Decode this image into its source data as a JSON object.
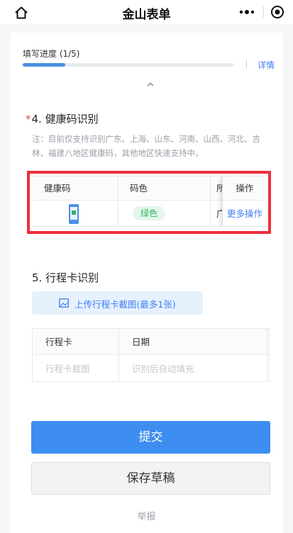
{
  "header": {
    "title": "金山表单"
  },
  "progress": {
    "label": "填写进度 (1/5)",
    "fraction": 0.2,
    "details_label": "详情"
  },
  "section4": {
    "required_mark": "*",
    "title": "4. 健康码识别",
    "note": "注：目前仅支持识别广东、上海、山东、河南、山西、河北、吉林、福建八地区健康码，其他地区快速支持中。",
    "table": {
      "headers": [
        "健康码",
        "码色",
        "所"
      ],
      "operation_header": "操作",
      "row": {
        "color_tag": "绿色",
        "region_partial": "广",
        "operation_link": "更多操作"
      }
    }
  },
  "section5": {
    "title": "5. 行程卡识别",
    "upload_label": "上传行程卡截图(最多1张)",
    "table": {
      "headers": [
        "行程卡",
        "日期"
      ],
      "placeholders": [
        "行程卡截图",
        "识别后自动填充"
      ]
    }
  },
  "actions": {
    "submit_label": "提交",
    "save_draft_label": "保存草稿",
    "report_label": "举报"
  },
  "colors": {
    "accent": "#3d8ef0",
    "link": "#3d7ff5",
    "highlight": "#ec2f3b",
    "green_tag_text": "#2fb463",
    "green_tag_bg": "#e5f7ec"
  }
}
